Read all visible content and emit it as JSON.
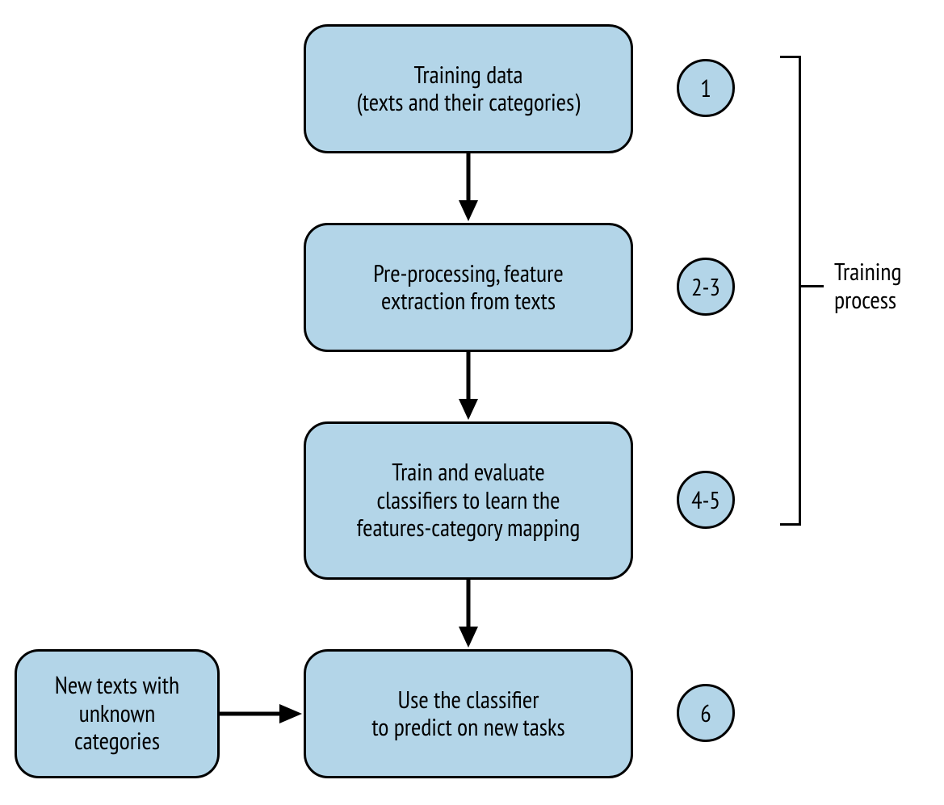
{
  "nodes": {
    "training_data": {
      "line1": "Training data",
      "line2": "(texts and their categories)"
    },
    "preprocessing": {
      "line1": "Pre-processing, feature",
      "line2": "extraction from texts"
    },
    "train_eval": {
      "line1": "Train and evaluate",
      "line2": "classifiers to learn the",
      "line3": "features-category mapping"
    },
    "use_classifier": {
      "line1": "Use the classifier",
      "line2": "to predict on new tasks"
    },
    "new_texts": {
      "line1": "New texts with",
      "line2": "unknown",
      "line3": "categories"
    }
  },
  "step_labels": {
    "s1": "1",
    "s2_3": "2-3",
    "s4_5": "4-5",
    "s6": "6"
  },
  "bracket_label": {
    "line1": "Training",
    "line2": "process"
  }
}
